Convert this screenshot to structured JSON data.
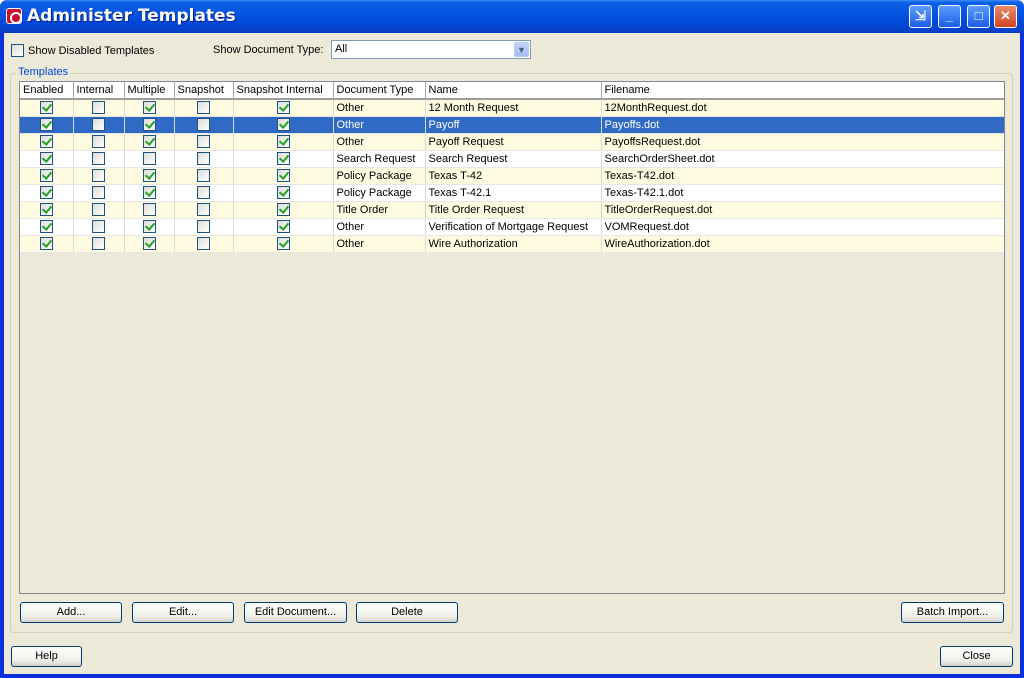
{
  "window": {
    "title": "Administer Templates"
  },
  "filters": {
    "show_disabled_label": "Show Disabled Templates",
    "show_disabled_checked": false,
    "doc_type_label": "Show Document Type:",
    "doc_type_value": "All"
  },
  "group": {
    "label": "Templates"
  },
  "table": {
    "columns": [
      "Enabled",
      "Internal",
      "Multiple",
      "Snapshot",
      "Snapshot Internal",
      "Document Type",
      "Name",
      "Filename"
    ],
    "rows": [
      {
        "enabled": true,
        "internal": false,
        "multiple": true,
        "snapshot": false,
        "snapshot_internal": true,
        "doc_type": "Other",
        "name": "12 Month Request",
        "filename": "12MonthRequest.dot"
      },
      {
        "enabled": true,
        "internal": false,
        "multiple": true,
        "snapshot": false,
        "snapshot_internal": true,
        "doc_type": "Other",
        "name": "Payoff",
        "filename": "Payoffs.dot",
        "selected": true
      },
      {
        "enabled": true,
        "internal": false,
        "multiple": true,
        "snapshot": false,
        "snapshot_internal": true,
        "doc_type": "Other",
        "name": "Payoff Request",
        "filename": "PayoffsRequest.dot"
      },
      {
        "enabled": true,
        "internal": false,
        "multiple": false,
        "snapshot": false,
        "snapshot_internal": true,
        "doc_type": "Search Request",
        "name": "Search Request",
        "filename": "SearchOrderSheet.dot"
      },
      {
        "enabled": true,
        "internal": false,
        "multiple": true,
        "snapshot": false,
        "snapshot_internal": true,
        "doc_type": "Policy Package",
        "name": "Texas T-42",
        "filename": "Texas-T42.dot"
      },
      {
        "enabled": true,
        "internal": false,
        "multiple": true,
        "snapshot": false,
        "snapshot_internal": true,
        "doc_type": "Policy Package",
        "name": "Texas T-42.1",
        "filename": "Texas-T42.1.dot"
      },
      {
        "enabled": true,
        "internal": false,
        "multiple": false,
        "snapshot": false,
        "snapshot_internal": true,
        "doc_type": "Title Order",
        "name": "Title Order Request",
        "filename": "TitleOrderRequest.dot"
      },
      {
        "enabled": true,
        "internal": false,
        "multiple": true,
        "snapshot": false,
        "snapshot_internal": true,
        "doc_type": "Other",
        "name": "Verification of Mortgage Request",
        "filename": "VOMRequest.dot"
      },
      {
        "enabled": true,
        "internal": false,
        "multiple": true,
        "snapshot": false,
        "snapshot_internal": true,
        "doc_type": "Other",
        "name": "Wire Authorization",
        "filename": "WireAuthorization.dot"
      }
    ]
  },
  "buttons": {
    "add": "Add...",
    "edit": "Edit...",
    "edit_document": "Edit Document...",
    "delete": "Delete",
    "batch_import": "Batch Import...",
    "help": "Help",
    "close": "Close"
  }
}
